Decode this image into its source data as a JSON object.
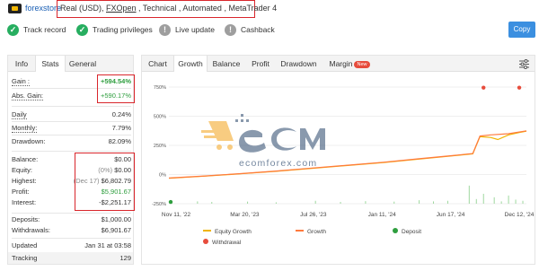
{
  "header": {
    "store_name": "forexstore",
    "account_prefix": "Real (USD), ",
    "broker": "FXOpen",
    "account_suffix": " , Technical , Automated , MetaTrader 4"
  },
  "status": {
    "track_record": "Track record",
    "trading_privileges": "Trading privileges",
    "live_update": "Live update",
    "cashback": "Cashback",
    "copy_button": "Copy"
  },
  "left_tabs": [
    "Info",
    "Stats",
    "General"
  ],
  "stats": {
    "gain_label": "Gain :",
    "gain_value": "+594.54%",
    "abs_gain_label": "Abs. Gain:",
    "abs_gain_value": "+590.17%",
    "daily_label": "Daily",
    "daily_value": "0.24%",
    "monthly_label": "Monthly:",
    "monthly_value": "7.79%",
    "drawdown_label": "Drawdown:",
    "drawdown_value": "82.09%",
    "balance_label": "Balance:",
    "balance_value": "$0.00",
    "equity_label": "Equity:",
    "equity_pct": "(0%)",
    "equity_value": "$0.00",
    "highest_label": "Highest:",
    "highest_date": "(Dec 17)",
    "highest_value": "$6,802.79",
    "profit_label": "Profit:",
    "profit_value": "$5,901.67",
    "interest_label": "Interest:",
    "interest_value": "-$2,251.17",
    "deposits_label": "Deposits:",
    "deposits_value": "$1,000.00",
    "withdrawals_label": "Withdrawals:",
    "withdrawals_value": "$6,901.67",
    "updated_label": "Updated",
    "updated_value": "Jan 31 at 03:58",
    "tracking_label": "Tracking",
    "tracking_value": "129"
  },
  "right_tabs": {
    "chart": "Chart",
    "growth": "Growth",
    "balance": "Balance",
    "profit": "Profit",
    "drawdown": "Drawdown",
    "margin": "Margin",
    "margin_badge": "New"
  },
  "watermark": {
    "text": "ecomforex.com"
  },
  "colors": {
    "growth": "#ff7a3d",
    "equity_growth": "#f0b400",
    "deposit": "#2e9e3e",
    "withdrawal": "#e74c3c",
    "accent": "#3b8fe0"
  },
  "chart_data": {
    "type": "line",
    "ylim": [
      -250,
      750
    ],
    "y_ticks": [
      "750%",
      "500%",
      "250%",
      "0%",
      "-250%"
    ],
    "y_tick_values": [
      750,
      500,
      250,
      0,
      -250
    ],
    "x_ticks": [
      "Nov 11, '22",
      "Mar 20, '23",
      "Jul 26, '23",
      "Jan 11, '24",
      "Jun 17, '24",
      "Dec 12, '24"
    ],
    "legend": [
      "Equity Growth",
      "Growth",
      "Deposit",
      "Withdrawal"
    ],
    "series": [
      {
        "name": "Growth",
        "x": [
          0,
          10,
          20,
          30,
          40,
          50,
          60,
          70,
          80,
          85,
          87,
          90,
          95,
          100
        ],
        "y": [
          -30,
          -12,
          8,
          30,
          55,
          80,
          105,
          135,
          165,
          180,
          330,
          340,
          350,
          375
        ]
      },
      {
        "name": "Equity Growth",
        "x": [
          0,
          10,
          20,
          30,
          40,
          50,
          60,
          70,
          80,
          85,
          87,
          90,
          92,
          95,
          98,
          100
        ],
        "y": [
          -32,
          -14,
          6,
          28,
          53,
          78,
          103,
          132,
          162,
          178,
          325,
          318,
          300,
          340,
          360,
          372
        ]
      }
    ],
    "daily_bars": [
      {
        "x": 8,
        "v": 20
      },
      {
        "x": 12,
        "v": 15
      },
      {
        "x": 22,
        "v": 18
      },
      {
        "x": 30,
        "v": 12
      },
      {
        "x": 41,
        "v": 25
      },
      {
        "x": 48,
        "v": 15
      },
      {
        "x": 55,
        "v": 22
      },
      {
        "x": 63,
        "v": 18
      },
      {
        "x": 70,
        "v": 30
      },
      {
        "x": 74,
        "v": 20
      },
      {
        "x": 78,
        "v": 25
      },
      {
        "x": 84,
        "v": 155
      },
      {
        "x": 86,
        "v": 40
      },
      {
        "x": 88,
        "v": 85
      },
      {
        "x": 91,
        "v": 55
      },
      {
        "x": 93,
        "v": 20
      },
      {
        "x": 95,
        "v": 70
      },
      {
        "x": 97,
        "v": 35
      },
      {
        "x": 99,
        "v": 25
      }
    ],
    "deposit_points": [
      {
        "x": 0,
        "y": -235
      }
    ],
    "withdrawal_points": [
      {
        "x": 88,
        "y": 745
      },
      {
        "x": 98,
        "y": 745
      }
    ]
  }
}
